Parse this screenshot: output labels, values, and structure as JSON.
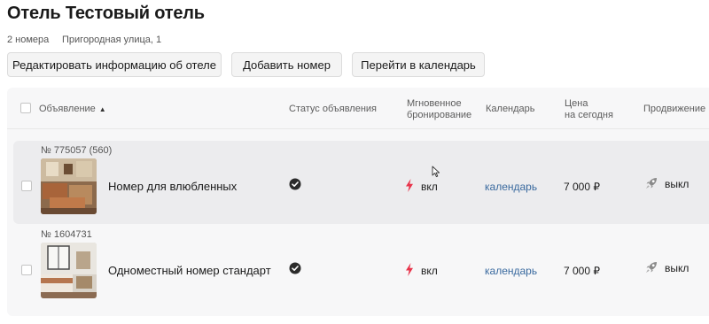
{
  "hotel": {
    "title": "Отель Тестовый отель",
    "rooms_count": "2 номера",
    "address": "Пригородная улица, 1"
  },
  "actions": {
    "edit_label": "Редактировать информацию об отеле",
    "add_room_label": "Добавить номер",
    "calendar_label": "Перейти в календарь"
  },
  "table": {
    "columns": {
      "listing": "Объявление",
      "status": "Статус объявления",
      "instant_line1": "Мгновенное",
      "instant_line2": "бронирование",
      "calendar": "Календарь",
      "price_line1": "Цена",
      "price_line2": "на сегодня",
      "promotion": "Продвижение"
    },
    "sort_indicator": "▲",
    "rows": [
      {
        "number": "№ 775057 (560)",
        "name": "Номер для влюбленных",
        "status_icon": "check-circle-icon",
        "instant_icon": "lightning-icon",
        "instant": "вкл",
        "calendar": "календарь",
        "price": "7 000 ₽",
        "promo_icon": "rocket-icon",
        "promotion": "выкл"
      },
      {
        "number": "№ 1604731",
        "name": "Одноместный номер стандарт",
        "status_icon": "check-circle-icon",
        "instant_icon": "lightning-icon",
        "instant": "вкл",
        "calendar": "календарь",
        "price": "7 000 ₽",
        "promo_icon": "rocket-icon",
        "promotion": "выкл"
      }
    ]
  },
  "colors": {
    "accent_link": "#3a6a9f",
    "bolt": "#e8334a",
    "row_hover": "#ececee",
    "panel": "#f7f7f8"
  }
}
